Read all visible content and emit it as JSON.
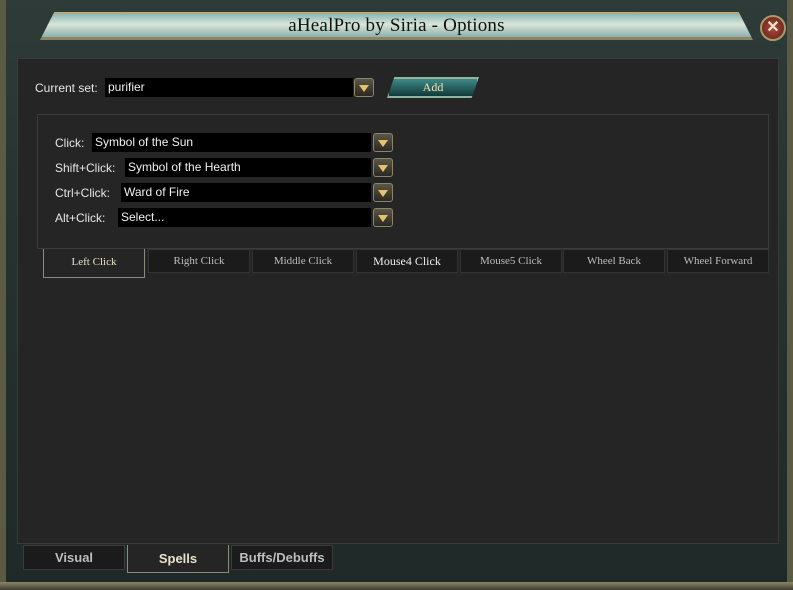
{
  "window": {
    "title": "aHealPro by Siria - Options",
    "close_icon": "x-icon"
  },
  "current_set": {
    "label": "Current set:",
    "value": "purifier",
    "add_label": "Add"
  },
  "bindings": [
    {
      "label": "Click:",
      "value": "Symbol of the Sun"
    },
    {
      "label": "Shift+Click:",
      "value": "Symbol of the Hearth"
    },
    {
      "label": "Ctrl+Click:",
      "value": "Ward of Fire"
    },
    {
      "label": "Alt+Click:",
      "value": "Select..."
    }
  ],
  "mouse_tabs": [
    {
      "label": "Left Click",
      "selected": true
    },
    {
      "label": "Right Click"
    },
    {
      "label": "Middle Click"
    },
    {
      "label": "Mouse4 Click"
    },
    {
      "label": "Mouse5 Click"
    },
    {
      "label": "Wheel Back"
    },
    {
      "label": "Wheel Forward"
    }
  ],
  "bottom_tabs": [
    {
      "label": "Visual"
    },
    {
      "label": "Spells",
      "selected": true
    },
    {
      "label": "Buffs/Debuffs"
    }
  ]
}
